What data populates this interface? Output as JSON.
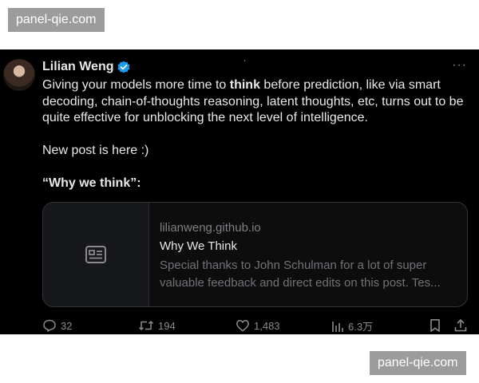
{
  "watermark": {
    "text": "panel-qie.com"
  },
  "tweet": {
    "author": {
      "name": "Lilian Weng",
      "verified": true
    },
    "more_icon": "more-horizontal-icon",
    "body": {
      "para1_pre": "Giving your models more time to ",
      "para1_bold": "think",
      "para1_post": " before prediction, like via smart decoding, chain-of-thoughts reasoning, latent thoughts, etc, turns out to be quite effective for unblocking the next level of intelligence.",
      "para2": "New post is here :)",
      "para3": "“Why we think”:"
    },
    "card": {
      "domain": "lilianweng.github.io",
      "title": "Why We Think",
      "desc_line1": "Special thanks to John Schulman for a lot of super",
      "desc_line2": "valuable feedback and direct edits on this post. Tes..."
    },
    "actions": {
      "replies": "32",
      "retweets": "194",
      "likes": "1,483",
      "views": "6.3万"
    }
  },
  "colors": {
    "background": "#000000",
    "text": "#e7e9ea",
    "muted": "#8b8b8b",
    "verified": "#1d9bf0"
  }
}
